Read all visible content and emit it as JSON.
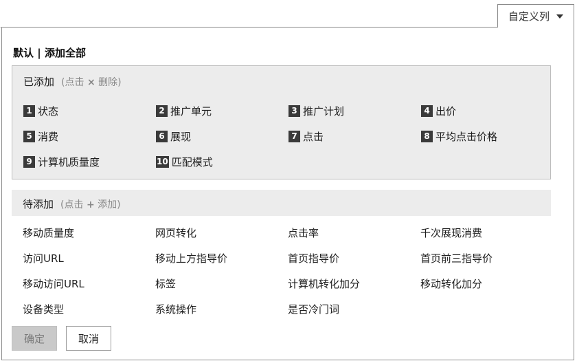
{
  "trigger": {
    "label": "自定义列"
  },
  "header": {
    "default_link": "默认",
    "separator": "|",
    "add_all_link": "添加全部"
  },
  "added": {
    "title": "已添加",
    "hint_prefix": "(点击",
    "hint_icon": "×",
    "hint_suffix": "删除)",
    "items": [
      {
        "num": "1",
        "label": "状态"
      },
      {
        "num": "2",
        "label": "推广单元"
      },
      {
        "num": "3",
        "label": "推广计划"
      },
      {
        "num": "4",
        "label": "出价"
      },
      {
        "num": "5",
        "label": "消费"
      },
      {
        "num": "6",
        "label": "展现"
      },
      {
        "num": "7",
        "label": "点击"
      },
      {
        "num": "8",
        "label": "平均点击价格"
      },
      {
        "num": "9",
        "label": "计算机质量度"
      },
      {
        "num": "10",
        "label": "匹配模式"
      }
    ]
  },
  "pending": {
    "title": "待添加",
    "hint_prefix": "(点击",
    "hint_icon": "+",
    "hint_suffix": "添加)",
    "items": [
      "移动质量度",
      "网页转化",
      "点击率",
      "千次展现消费",
      "访问URL",
      "移动上方指导价",
      "首页指导价",
      "首页前三指导价",
      "移动访问URL",
      "标签",
      "计算机转化加分",
      "移动转化加分",
      "设备类型",
      "系统操作",
      "是否冷门词"
    ]
  },
  "buttons": {
    "ok": "确定",
    "cancel": "取消"
  }
}
